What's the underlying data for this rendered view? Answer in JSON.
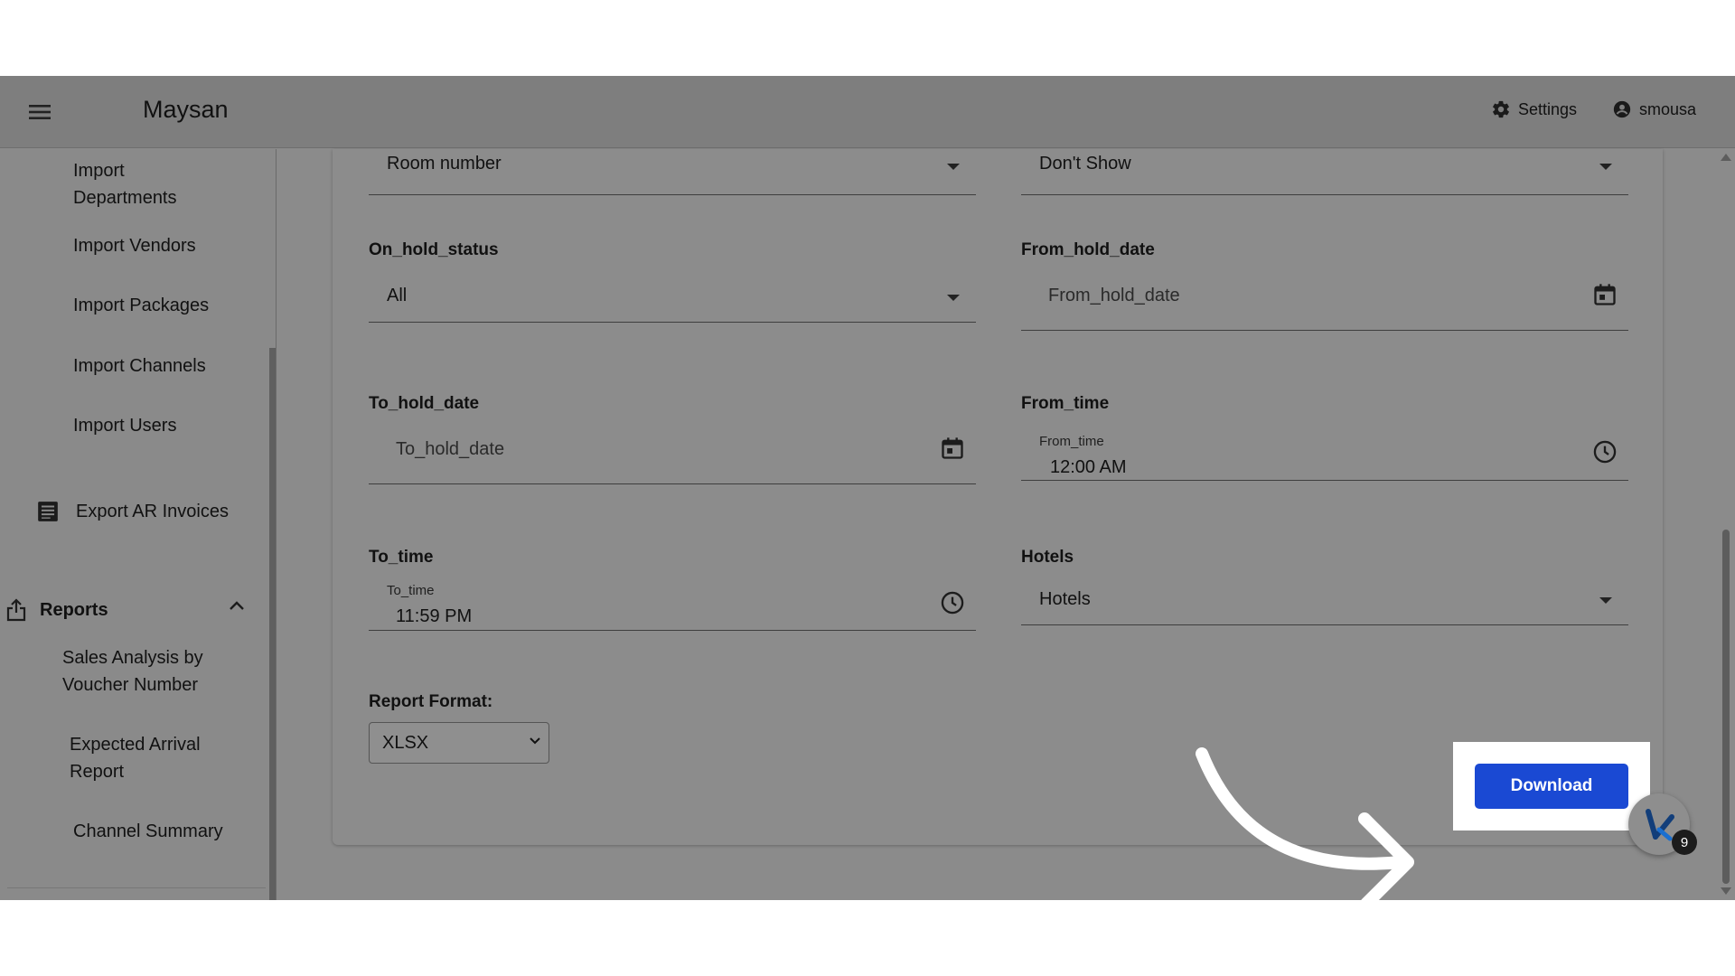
{
  "header": {
    "brand": "Maysan",
    "settings_label": "Settings",
    "user_name": "smousa"
  },
  "sidebar": {
    "items": [
      {
        "label": "Import\nDepartments"
      },
      {
        "label": "Import Vendors"
      },
      {
        "label": "Import Packages"
      },
      {
        "label": "Import Channels"
      },
      {
        "label": "Import Users"
      }
    ],
    "export_label": "Export AR Invoices",
    "reports_label": "Reports",
    "report_items": [
      {
        "label": "Sales Analysis by\nVoucher Number"
      },
      {
        "label": "Expected Arrival\nReport"
      },
      {
        "label": "Channel Summary"
      }
    ]
  },
  "form": {
    "sort_by_value": "Room number",
    "show_value": "Don't Show",
    "on_hold_status_label": "On_hold_status",
    "on_hold_status_value": "All",
    "from_hold_date_label": "From_hold_date",
    "from_hold_date_placeholder": "From_hold_date",
    "to_hold_date_label": "To_hold_date",
    "to_hold_date_placeholder": "To_hold_date",
    "from_time_label": "From_time",
    "from_time_small": "From_time",
    "from_time_value": "12:00  AM",
    "to_time_label": "To_time",
    "to_time_small": "To_time",
    "to_time_value": "11:59  PM",
    "hotels_label": "Hotels",
    "hotels_value": "Hotels",
    "report_format_label": "Report Format:",
    "report_format_value": "XLSX"
  },
  "actions": {
    "download_label": "Download"
  },
  "fab": {
    "count": "9"
  },
  "colors": {
    "accent": "#1a49d3",
    "overlay": "#8b8b8b"
  }
}
